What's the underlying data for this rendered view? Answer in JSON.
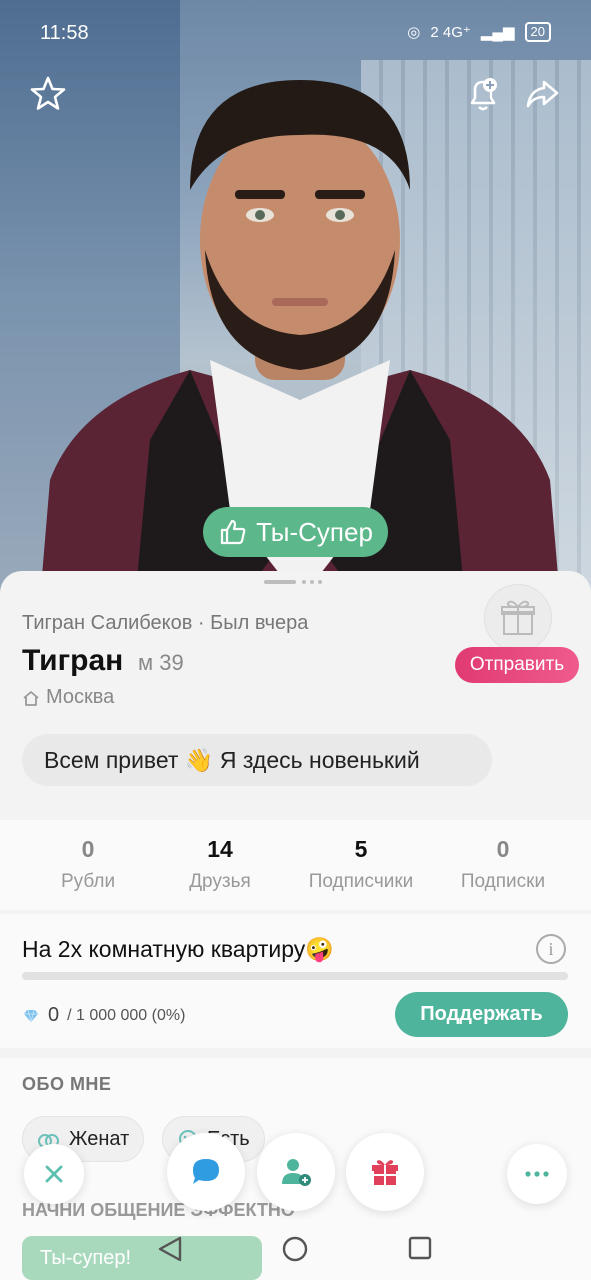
{
  "status_bar": {
    "time": "11:58",
    "network": "2 4G⁺",
    "battery": "20"
  },
  "top_bar": {
    "favorite_icon": "star-icon",
    "notify_icon": "bell-plus-icon",
    "share_icon": "share-arrow-icon"
  },
  "photo": {
    "super_button_label": "Ты-Супер",
    "super_icon": "thumbs-up-icon"
  },
  "profile": {
    "full_name": "Тигран Салибеков",
    "separator": " · ",
    "last_seen": "Был вчера",
    "name": "Тигран",
    "gender_age": "м 39",
    "city": "Москва",
    "status_message": "Всем привет 👋 Я здесь новенький",
    "gift_icon": "gift-icon",
    "send_button": "Отправить"
  },
  "stats": [
    {
      "value": "0",
      "label": "Рубли"
    },
    {
      "value": "14",
      "label": "Друзья"
    },
    {
      "value": "5",
      "label": "Подписчики"
    },
    {
      "value": "0",
      "label": "Подписки"
    }
  ],
  "goal": {
    "title": "На 2х комнатную квартиру🤪",
    "current": "0",
    "target": "/ 1 000 000 (0%)",
    "progress_fraction": 0,
    "support_button": "Поддержать",
    "currency_icon": "diamond-icon"
  },
  "about": {
    "title": "ОБО МНЕ",
    "tags": [
      {
        "label": "Женат",
        "icon": "rings-icon"
      },
      {
        "label": "Есть",
        "icon": "cookie-icon"
      }
    ]
  },
  "start_chat": {
    "title": "НАЧНИ ОБЩЕНИЕ ЭФФЕКТНО",
    "chip": "Ты-супер!"
  },
  "actions": {
    "close": "close-icon",
    "chat": "chat-icon",
    "add_friend": "add-friend-icon",
    "gift": "gift-icon",
    "more": "more-icon"
  },
  "colors": {
    "accent_green": "#5cb88b",
    "teal": "#4fb49c",
    "pink": "#e03a73",
    "chat_blue": "#2f9be0",
    "gift_red": "#e0405a"
  }
}
